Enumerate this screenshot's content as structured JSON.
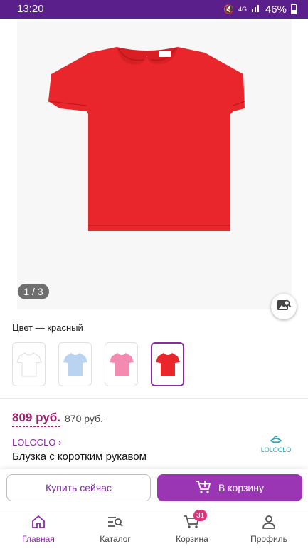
{
  "status_bar": {
    "time": "13:20",
    "network": "4G",
    "battery": "46%"
  },
  "gallery": {
    "page_indicator": "1 / 3",
    "product_color_hex": "#e8262b"
  },
  "color_section": {
    "label": "Цвет — красный",
    "swatches": [
      {
        "name": "white",
        "hex": "#ffffff"
      },
      {
        "name": "light-blue",
        "hex": "#b9d3f0"
      },
      {
        "name": "pink",
        "hex": "#f38bb0"
      },
      {
        "name": "red",
        "hex": "#e8262b",
        "selected": true
      }
    ]
  },
  "product": {
    "price": "809 руб.",
    "old_price": "870 руб.",
    "brand": "LOLOCLO ›",
    "title": "Блузка с коротким рукавом",
    "brand_logo_text": "LOLOCLO"
  },
  "actions": {
    "buy_now": "Купить сейчас",
    "add_to_cart": "В корзину"
  },
  "bottom_nav": {
    "items": [
      {
        "label": "Главная",
        "icon": "home-icon",
        "active": true
      },
      {
        "label": "Каталог",
        "icon": "catalog-icon"
      },
      {
        "label": "Корзина",
        "icon": "cart-icon",
        "badge": "31"
      },
      {
        "label": "Профиль",
        "icon": "profile-icon"
      }
    ]
  },
  "colors": {
    "accent": "#9a35b4",
    "price": "#a0206f",
    "status_bar": "#5a1f8a",
    "badge": "#e0317b"
  }
}
